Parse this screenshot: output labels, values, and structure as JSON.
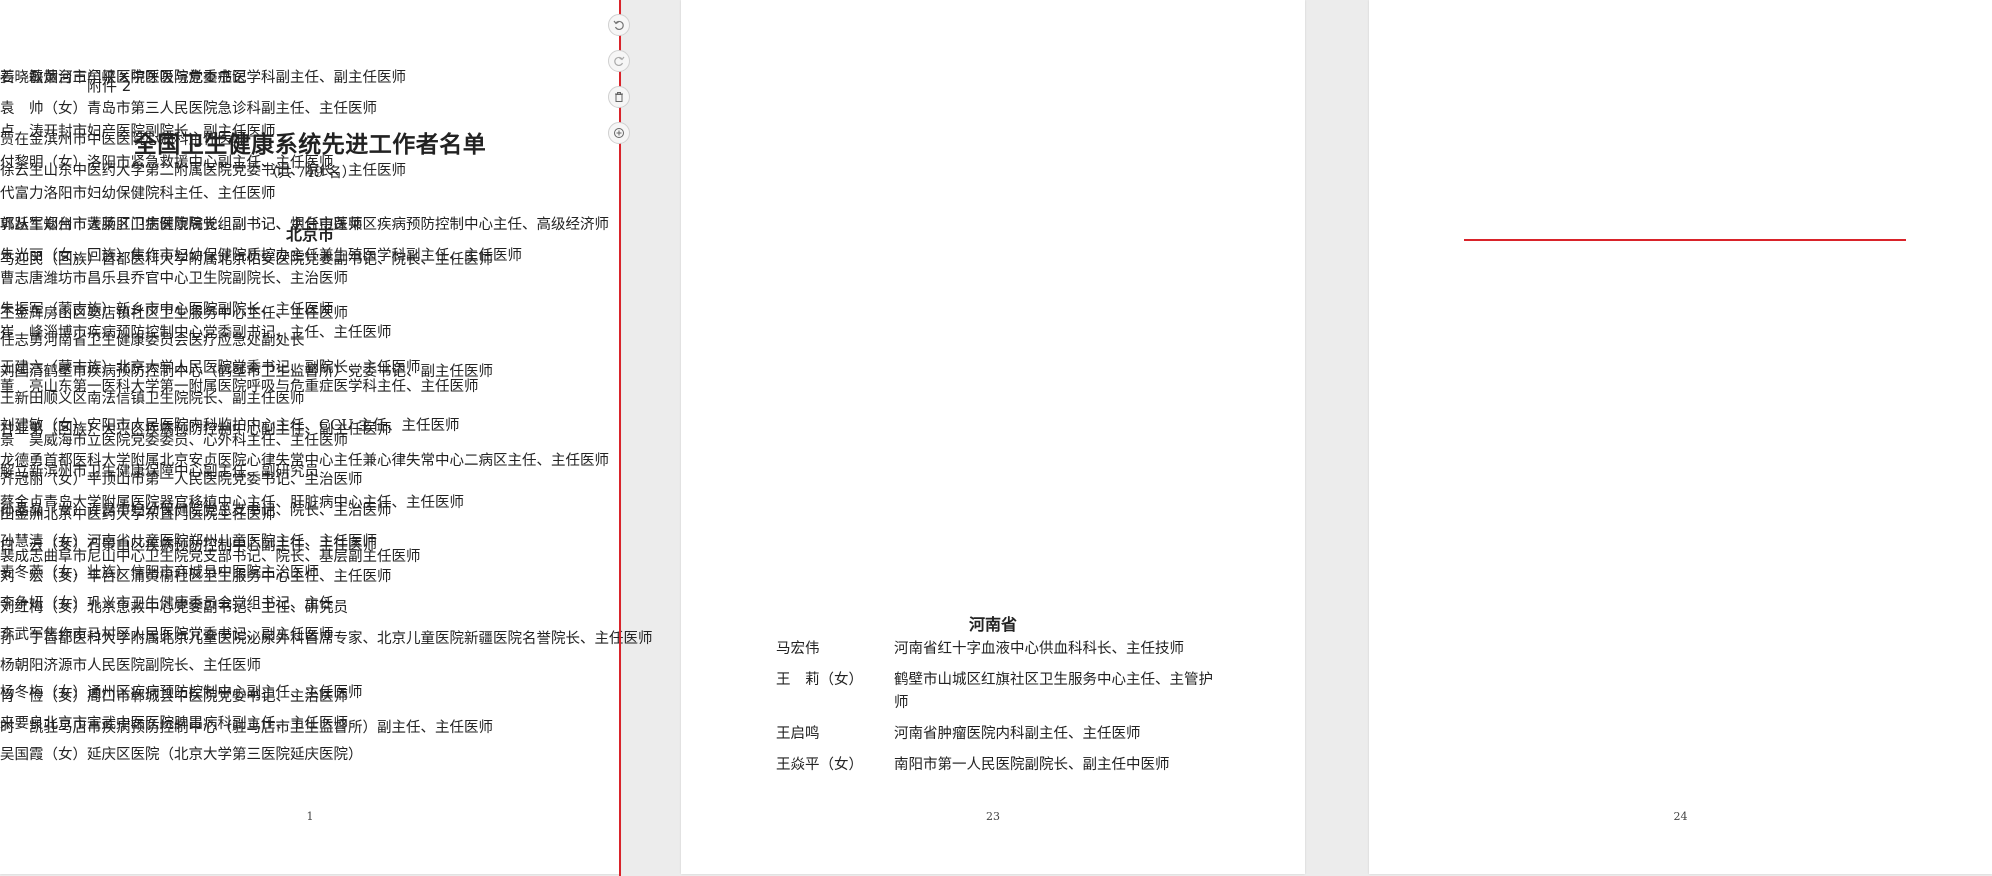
{
  "document": {
    "attachment_label": "附件 2",
    "title": "全国卫生健康系统先进工作者名单",
    "subtitle": "（共 749 名）"
  },
  "page1": {
    "page_number": "1",
    "region": "北京市",
    "entries": [
      {
        "name": "马迎民（回族）",
        "desc": "首都医科大学附属北京佑安医院党委副书记、院长、主任医师"
      },
      {
        "name": "王金辉",
        "desc": "房山区窦店镇社区卫生服务中心主任、主任医师"
      },
      {
        "name": "王建六（蒙古族）",
        "desc": "北京大学人民医院党委书记、副院长、主任医师"
      },
      {
        "name": "王新田",
        "desc": "顺义区南法信镇卫生院院长、副主任医师"
      },
      {
        "name": "甘亚弟（回族）",
        "desc": "大兴区疾病预防控制中心副主任、副主任医师"
      },
      {
        "name": "龙德勇",
        "desc": "首都医科大学附属北京安贞医院心律失常中心主任兼心律失常中心二病区主任、主任医师"
      },
      {
        "name": "田金洲",
        "desc": "北京中医药大学东直门医院主任医师"
      },
      {
        "name": "白　云（女）",
        "desc": "石景山区疾病预防控制中心副主任、主任医师"
      },
      {
        "name": "刘　宏（女）",
        "desc": "丰台区蒲黄榆社区卫生服务中心主任、主任医师"
      },
      {
        "name": "刘红梅（女）",
        "desc": "北京急救中心党委副书记、主任、研究员"
      },
      {
        "name": "孙　宁",
        "desc": "首都医科大学附属北京儿童医院泌尿外科首席专家、北京儿童医院新疆医院名誉院长、主任医师"
      },
      {
        "name": "杨冬梅（女）",
        "desc": "通州区疾病预防控制中心副主任、主任医师"
      },
      {
        "name": "来要良",
        "desc": "北京市宣武中医医院脾胃病科副主任、主任医师"
      },
      {
        "name": "吴国霞（女）",
        "desc": "延庆区医院（北京大学第三医院延庆医院）"
      }
    ]
  },
  "page2": {
    "page_number": "23",
    "entries_a": [
      {
        "name": "姜晓敏",
        "desc": "烟台市牟平区中医医院党委书记"
      },
      {
        "name": "袁　帅（女）",
        "desc": "青岛市第三人民医院急诊科副主任、主任医师"
      },
      {
        "name": "贾在金",
        "desc": "滨州市中医医院心病科主任医师"
      },
      {
        "name": "徐云生",
        "desc": "山东中医药大学第二附属医院党委书记、院长、主任医师"
      },
      {
        "name": "郭丛军",
        "desc": "烟台市蓬莱区卫生健康局党组副书记、烟台市蓬莱区疾病预防控制中心主任、高级经济师"
      },
      {
        "name": "曹志唐",
        "desc": "潍坊市昌乐县乔官中心卫生院副院长、主治医师"
      },
      {
        "name": "崔　峰",
        "desc": "淄博市疾病预防控制中心党委副书记、主任、主任医师"
      },
      {
        "name": "董　亮",
        "desc": "山东第一医科大学第一附属医院呼吸与危重症医学科主任、主任医师"
      },
      {
        "name": "景　昊",
        "desc": "威海市立医院党委委员、心外科主任、主任医师"
      },
      {
        "name": "解立新",
        "desc": "滨州市卫生健康保障中心副主任、副研究员"
      },
      {
        "name": "蔡金贞",
        "desc": "青岛大学附属医院器官移植中心主任、肝脏病中心主任、主任医师"
      },
      {
        "name": "裴成志",
        "desc": "曲阜市尼山中心卫生院党支部书记、院长、基层副主任医师"
      }
    ],
    "region": "河南省",
    "entries_b": [
      {
        "name": "马宏伟",
        "desc": "河南省红十字血液中心供血科科长、主任技师"
      },
      {
        "name": "王　莉（女）",
        "desc": "鹤壁市山城区红旗社区卫生服务中心主任、主管护师"
      },
      {
        "name": "王启鸣",
        "desc": "河南省肿瘤医院内科副主任、主任医师"
      },
      {
        "name": "王焱平（女）",
        "desc": "南阳市第一人民医院副院长、副主任中医师"
      }
    ]
  },
  "page3": {
    "page_number": "24",
    "entries": [
      {
        "name": "石　磊",
        "desc": "黄河三门峡医院呼吸与危重症医学科副主任、副主任医师"
      },
      {
        "name": "卢　涛",
        "desc": "开封市妇产医院副院长、副主任医师"
      },
      {
        "name": "付黎明（女）",
        "desc": "洛阳市紧急救援中心副主任、主任医师"
      },
      {
        "name": "代富力",
        "desc": "洛阳市妇幼保健院科主任、主任医师"
      },
      {
        "name": "巩跃生",
        "desc": "郑州市大肠肛门病医院院长、副书记、主任中医师"
      },
      {
        "name": "朱光丽（女，回族）",
        "desc": "焦作市妇幼保健院质控办主任兼生殖医学科副主任、主任医师"
      },
      {
        "name": "朱振军（蒙古族）",
        "desc": "新乡市中心医院副院长、主任医师"
      },
      {
        "name": "任志勇",
        "desc": "河南省卫生健康委员会医疗应急处副处长"
      },
      {
        "name": "刘国清",
        "desc": "鹤壁市疾病预防控制中心（鹤壁市卫生监督所）党委书记、副主任医师"
      },
      {
        "name": "刘建敏（女）",
        "desc": "安阳市人民医院内科监护中心主任、CCU 主任、主任医师"
      },
      {
        "name": "齐冠丽（女）",
        "desc": "平顶山市第一人民医院党委书记、主治医师"
      },
      {
        "name": "孙晶晶（女）",
        "desc": "许昌市妇幼保健院党总支书记、院长、主治医师"
      },
      {
        "name": "孙慧清（女）",
        "desc": "河南省儿童医院郑州儿童医院主任、主任医师"
      },
      {
        "name": "麦冬燕（女，壮族）",
        "desc": "信阳市商城县中医院主治医师"
      },
      {
        "name": "李争妍（女）",
        "desc": "巩义市卫生健康委员会党组书记、主任"
      },
      {
        "name": "李武军",
        "desc": "焦作市马村区人民医院党委书记、副主任医师"
      },
      {
        "name": "杨朝阳",
        "desc": "济源市人民医院副院长、主任医师"
      },
      {
        "name": "肖　俭（女）",
        "desc": "周口市郸城县中医院党委书记、主治医师"
      },
      {
        "name": "时　凯",
        "desc": "驻马店市疾病预防控制中心（驻马店市卫生监督所）副主任、主任医师"
      }
    ]
  },
  "toolbar": {
    "icons": [
      "rotate-left-icon",
      "rotate-right-icon",
      "trash-icon",
      "zoom-in-icon"
    ]
  },
  "colors": {
    "accent": "#d9232a",
    "background": "#ececec"
  }
}
